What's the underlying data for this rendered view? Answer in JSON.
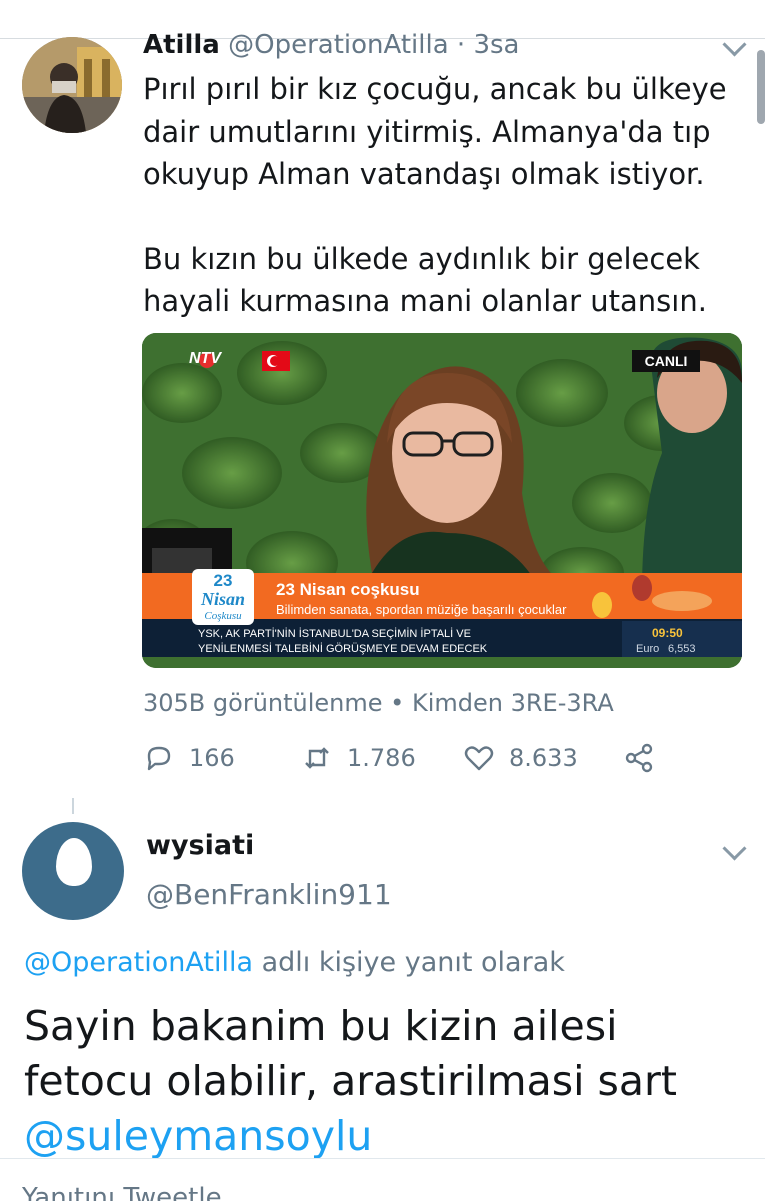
{
  "tweet": {
    "author_name": "Atilla",
    "author_handle": "@OperationAtilla",
    "separator": " · ",
    "time": "3sa",
    "text_p1": "Pırıl pırıl bir kız çocuğu, ancak bu ülkeye dair umutlarını yitirmiş. Almanya'da tıp okuyup Alman vatandaşı olmak istiyor.",
    "text_p2": "Bu kızın bu ülkede aydınlık bir gelecek hayali kurmasına mani olanlar utansın.",
    "media": {
      "channel_logo": "NTV",
      "live_badge": "CANLI",
      "event_logo_line1": "23",
      "event_logo_line2": "Nisan",
      "event_logo_line3": "Coşkusu",
      "headline": "23 Nisan coşkusu",
      "subheadline": "Bilimden sanata, spordan müziğe başarılı çocuklar",
      "ticker_line1": "YSK, AK PARTİ'NİN İSTANBUL'DA SEÇİMİN İPTALİ VE",
      "ticker_line2": "YENİLENMESİ TALEBİNİ GÖRÜŞMEYE DEVAM EDECEK",
      "clock": "09:50",
      "currency_label": "Euro",
      "currency_value": "6,553"
    },
    "views": "305B görüntülenme",
    "dot": " • ",
    "source": "Kimden 3RE-3RA",
    "replies": "166",
    "retweets": "1.786",
    "likes": "8.633"
  },
  "reply": {
    "author_name": "wysiati",
    "author_handle": "@BenFranklin911",
    "reply_to_handle": "@OperationAtilla",
    "reply_to_suffix": " adlı kişiye yanıt olarak",
    "text_line1": "Sayin bakanim bu kizin ailesi",
    "text_line2": "fetocu olabilir, arastirilmasi sart",
    "mention": "@suleymansoylu"
  },
  "bottom_bar_cut_text": "Yanıtını Tweetle",
  "colors": {
    "link": "#1da1f2",
    "muted": "#657786",
    "text": "#14171a",
    "ticker_orange": "#f26a21",
    "ticker_dark": "#0d2036"
  }
}
